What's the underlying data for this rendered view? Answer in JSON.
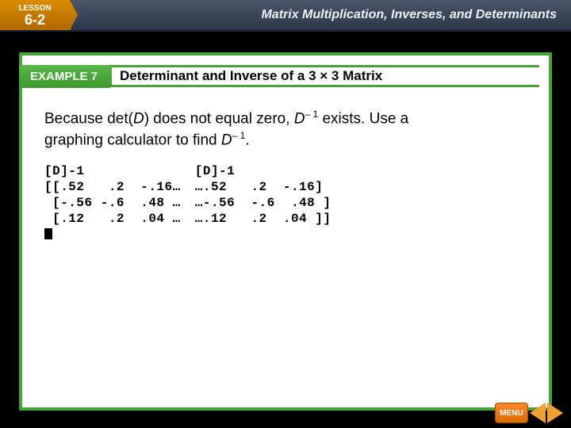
{
  "header": {
    "lesson_label": "LESSON",
    "lesson_number": "6-2",
    "chapter_title": "Matrix Multiplication, Inverses, and Determinants"
  },
  "example": {
    "tag": "EXAMPLE 7",
    "title": "Determinant and Inverse of a 3 × 3 Matrix"
  },
  "body": {
    "line1a": "Because det(",
    "line1b": "D",
    "line1c": ") does not equal zero, ",
    "line1d": "D",
    "line1e": "– 1",
    "line1f": " exists. Use a",
    "line2a": "graphing calculator to find ",
    "line2b": "D",
    "line2c": "– 1",
    "line2d": "."
  },
  "calc": {
    "left": "[D]-1\n[[.52   .2  -.16…\n [-.56 -.6  .48 …\n [.12   .2  .04 …",
    "right": "[D]-1\n….52   .2  -.16]\n…-.56  -.6  .48 ]\n….12   .2  .04 ]]"
  },
  "nav": {
    "menu": "MENU"
  }
}
